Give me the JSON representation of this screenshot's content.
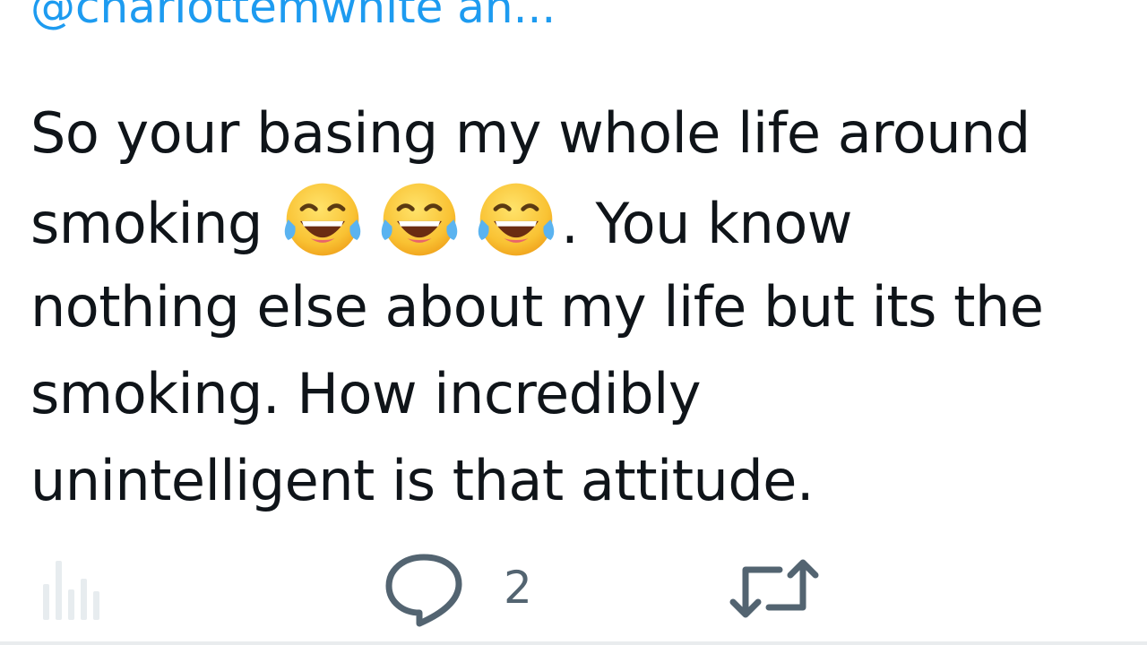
{
  "tweet": {
    "handle_line": "@charlottemwhite an...",
    "lines": {
      "l1": "So your basing my whole life around",
      "l2_before": "smoking ",
      "l2_after": ". You know",
      "l3": "nothing else about my life but its the",
      "l4": "smoking. How incredibly",
      "l5": "unintelligent is that attitude."
    },
    "emojis": [
      "face-with-tears-of-joy-icon",
      "face-with-tears-of-joy-icon",
      "face-with-tears-of-joy-icon"
    ]
  },
  "actions": {
    "reply_count": "2"
  },
  "colors": {
    "text": "#0f1419",
    "link": "#1d9bf0",
    "icon": "#536471",
    "icon_faded": "#e1e8ed"
  }
}
